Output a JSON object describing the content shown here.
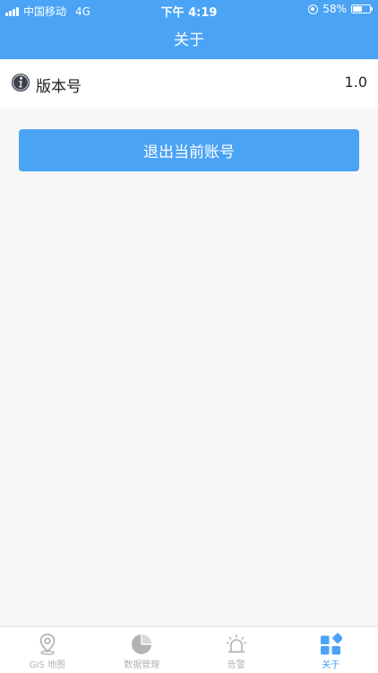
{
  "status_bar": {
    "carrier": "中国移动",
    "network": "4G",
    "time": "下午 4:19",
    "battery_text": "58%",
    "battery_level": 0.58
  },
  "header": {
    "title": "关于"
  },
  "info": {
    "label": "版本号",
    "value": "1.0",
    "icon": "info-icon"
  },
  "logout": {
    "label": "退出当前账号"
  },
  "tabs": [
    {
      "label": "GIS 地图",
      "icon": "map-pin-icon",
      "active": false
    },
    {
      "label": "数据管理",
      "icon": "pie-chart-icon",
      "active": false
    },
    {
      "label": "告警",
      "icon": "alarm-icon",
      "active": false
    },
    {
      "label": "关于",
      "icon": "grid-diamond-icon",
      "active": true
    }
  ],
  "colors": {
    "primary": "#4aa3f5",
    "background": "#f7f7f7",
    "inactive_tab": "#b3b3b3"
  }
}
